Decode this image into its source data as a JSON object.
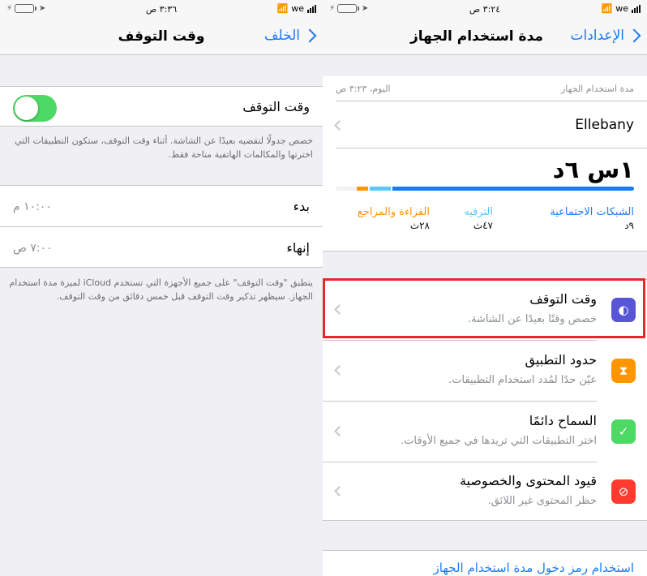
{
  "left": {
    "status": {
      "time": "٣:٣٦ ص",
      "carrier": "we"
    },
    "nav": {
      "back_label": "الخلف",
      "title": "وقت التوقف"
    },
    "toggle": {
      "label": "وقت التوقف",
      "state": "on"
    },
    "description": "خصص جدولًا لتقضيه بعيدًا عن الشاشة. أثناء وقت التوقف، ستكون التطبيقات التي اخترتها والمكالمات الهاتفية متاحة فقط.",
    "schedule": [
      {
        "label": "بدء",
        "value": "١٠:٠٠ م"
      },
      {
        "label": "إنهاء",
        "value": "٧:٠٠ ص"
      }
    ],
    "footer": "ينطبق \"وقت التوقف\" على جميع الأجهزة التي تستخدم iCloud لميزة مدة استخدام الجهاز. سيظهر تذكير وقت التوقف قبل خمس دقائق من وقت التوقف."
  },
  "right": {
    "status": {
      "time": "٣:٢٤ ص",
      "carrier": "we"
    },
    "nav": {
      "back_label": "الإعدادات",
      "title": "مدة استخدام الجهاز"
    },
    "summary": {
      "section_label": "مدة استخدام الجهاز",
      "date_label": "اليوم، ٣:٢٣ ص",
      "device": "Ellebany",
      "total": "١س ٦د",
      "categories": [
        {
          "name": "الشبكات الاجتماعية",
          "time": "٩د",
          "color": "#1a7af8",
          "share": 0.81
        },
        {
          "name": "الترفيه",
          "time": "٤٧ث",
          "color": "#5ac8fa",
          "share": 0.07
        },
        {
          "name": "القراءة والمراجع",
          "time": "٢٨ث",
          "color": "#ff9500",
          "share": 0.04
        }
      ]
    },
    "menu": [
      {
        "title": "وقت التوقف",
        "subtitle": "خصص وقتًا بعيدًا عن الشاشة.",
        "icon": "downtime-icon",
        "color": "#5856d6"
      },
      {
        "title": "حدود التطبيق",
        "subtitle": "عيّن حدًا لمُدد استخدام التطبيقات.",
        "icon": "hourglass-icon",
        "color": "#ff9500"
      },
      {
        "title": "السماح دائمًا",
        "subtitle": "اختر التطبيقات التي تريدها في جميع الأوقات.",
        "icon": "checkmark-badge-icon",
        "color": "#4cd964"
      },
      {
        "title": "قيود المحتوى والخصوصية",
        "subtitle": "حظر المحتوى غير اللائق.",
        "icon": "restriction-icon",
        "color": "#ff3b30"
      }
    ],
    "bottom_link": "استخدام رمز دخول مدة استخدام الجهاز"
  }
}
